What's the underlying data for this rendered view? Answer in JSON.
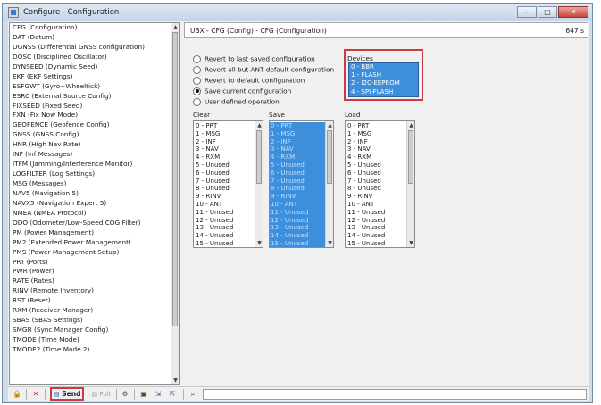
{
  "window": {
    "title": "Configure - Configuration",
    "buttons": {
      "minimize": "—",
      "maximize": "□",
      "close": "✕"
    }
  },
  "left_list": {
    "items": [
      "CFG (Configuration)",
      "DAT (Datum)",
      "DGNSS (Differential GNSS configuration)",
      "DOSC (Disciplined Oscillator)",
      "DYNSEED (Dynamic Seed)",
      "EKF (EKF Settings)",
      "ESFGWT (Gyro+Wheeltick)",
      "ESRC (External Source Config)",
      "FIXSEED (Fixed Seed)",
      "FXN (Fix Now Mode)",
      "GEOFENCE (Geofence Config)",
      "GNSS (GNSS Config)",
      "HNR (High Nav Rate)",
      "INF (Inf Messages)",
      "ITFM (Jamming/Interference Monitor)",
      "LOGFILTER (Log Settings)",
      "MSG (Messages)",
      "NAV5 (Navigation 5)",
      "NAVX5 (Navigation Expert 5)",
      "NMEA (NMEA Protocol)",
      "ODO (Odometer/Low-Speed COG Filter)",
      "PM (Power Management)",
      "PM2 (Extended Power Management)",
      "PMS (Power Management Setup)",
      "PRT (Ports)",
      "PWR (Power)",
      "RATE (Rates)",
      "RINV (Remote Inventory)",
      "RST (Reset)",
      "RXM (Receiver Manager)",
      "SBAS (SBAS Settings)",
      "SMGR (Sync Manager Config)",
      "TMODE (Time Mode)",
      "TMODE2 (Time Mode 2)"
    ]
  },
  "panel": {
    "header_title": "UBX - CFG (Config) - CFG (Configuration)",
    "header_rate": "647 s",
    "options": [
      {
        "label": "Revert to last saved configuration",
        "selected": false
      },
      {
        "label": "Revert all but ANT default configuration",
        "selected": false
      },
      {
        "label": "Revert to default configuration",
        "selected": false
      },
      {
        "label": "Save current configuration",
        "selected": true
      },
      {
        "label": "User defined operation",
        "selected": false
      }
    ],
    "devices": {
      "label": "Devices",
      "items": [
        "0 - BBR",
        "1 - FLASH",
        "2 - I2C-EEPROM",
        "4 - SPI-FLASH"
      ],
      "highlight_color": "#cc3b42"
    },
    "columns": {
      "clear_label": "Clear",
      "save_label": "Save",
      "load_label": "Load"
    },
    "sections": [
      "0 - PRT",
      "1 - MSG",
      "2 - INF",
      "3 - NAV",
      "4 - RXM",
      "5 - Unused",
      "6 - Unused",
      "7 - Unused",
      "8 - Unused",
      "9 - RINV",
      "10 - ANT",
      "11 - Unused",
      "12 - Unused",
      "13 - Unused",
      "14 - Unused",
      "15 - Unused"
    ],
    "selection_color": "#3d8fdb"
  },
  "toolbar": {
    "send_label": "Send",
    "poll_label": "Poll",
    "icons": [
      "lock-icon",
      "delete-icon",
      "send-icon",
      "poll-icon",
      "tools-icon",
      "save-icon",
      "export-icon",
      "import-icon",
      "binoculars-icon"
    ]
  }
}
